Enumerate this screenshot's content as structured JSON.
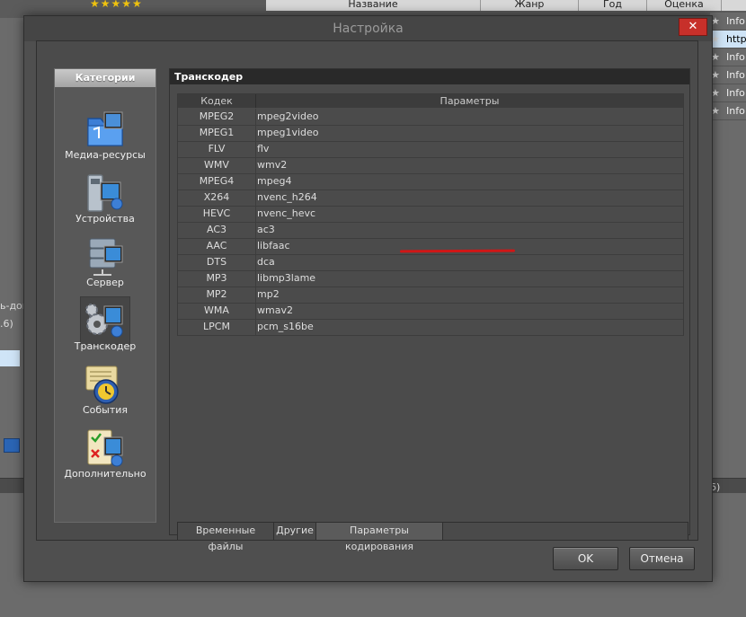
{
  "background": {
    "header_columns": [
      "Название",
      "Жанр",
      "Год",
      "Оценка"
    ],
    "right_list": [
      "Info",
      "http",
      "Info",
      "Info",
      "Info",
      "Info"
    ],
    "left_fragments": [
      "ь-дон",
      ".6)"
    ],
    "bottom_fragment": "6)"
  },
  "dialog": {
    "title": "Настройка",
    "close_label": "✕",
    "categories_title": "Категории",
    "categories": [
      {
        "label": "Медиа-ресурсы",
        "icon": "media-folder-icon"
      },
      {
        "label": "Устройства",
        "icon": "devices-icon"
      },
      {
        "label": "Сервер",
        "icon": "server-icon"
      },
      {
        "label": "Транскодер",
        "icon": "transcoder-gear-icon"
      },
      {
        "label": "События",
        "icon": "events-clock-icon"
      },
      {
        "label": "Дополнительно",
        "icon": "extra-checklist-icon"
      }
    ],
    "active_category": "Транскодер",
    "panel_title": "Транскодер",
    "table": {
      "columns": [
        "Кодек",
        "Параметры"
      ],
      "rows": [
        [
          "MPEG2",
          "mpeg2video"
        ],
        [
          "MPEG1",
          "mpeg1video"
        ],
        [
          "FLV",
          "flv"
        ],
        [
          "WMV",
          "wmv2"
        ],
        [
          "MPEG4",
          "mpeg4"
        ],
        [
          "X264",
          "nvenc_h264"
        ],
        [
          "HEVC",
          "nvenc_hevc"
        ],
        [
          "AC3",
          "ac3"
        ],
        [
          "AAC",
          "libfaac"
        ],
        [
          "DTS",
          "dca"
        ],
        [
          "MP3",
          "libmp3lame"
        ],
        [
          "MP2",
          "mp2"
        ],
        [
          "WMA",
          "wmav2"
        ],
        [
          "LPCM",
          "pcm_s16be"
        ]
      ]
    },
    "tabs": [
      "Временные файлы",
      "Другие",
      "Параметры кодирования"
    ],
    "active_tab": "Параметры кодирования",
    "ok_label": "OK",
    "cancel_label": "Отмена",
    "colors": {
      "close": "#c7302a",
      "highlight_mark": "#d01616",
      "stars": "#f1c40f"
    }
  }
}
